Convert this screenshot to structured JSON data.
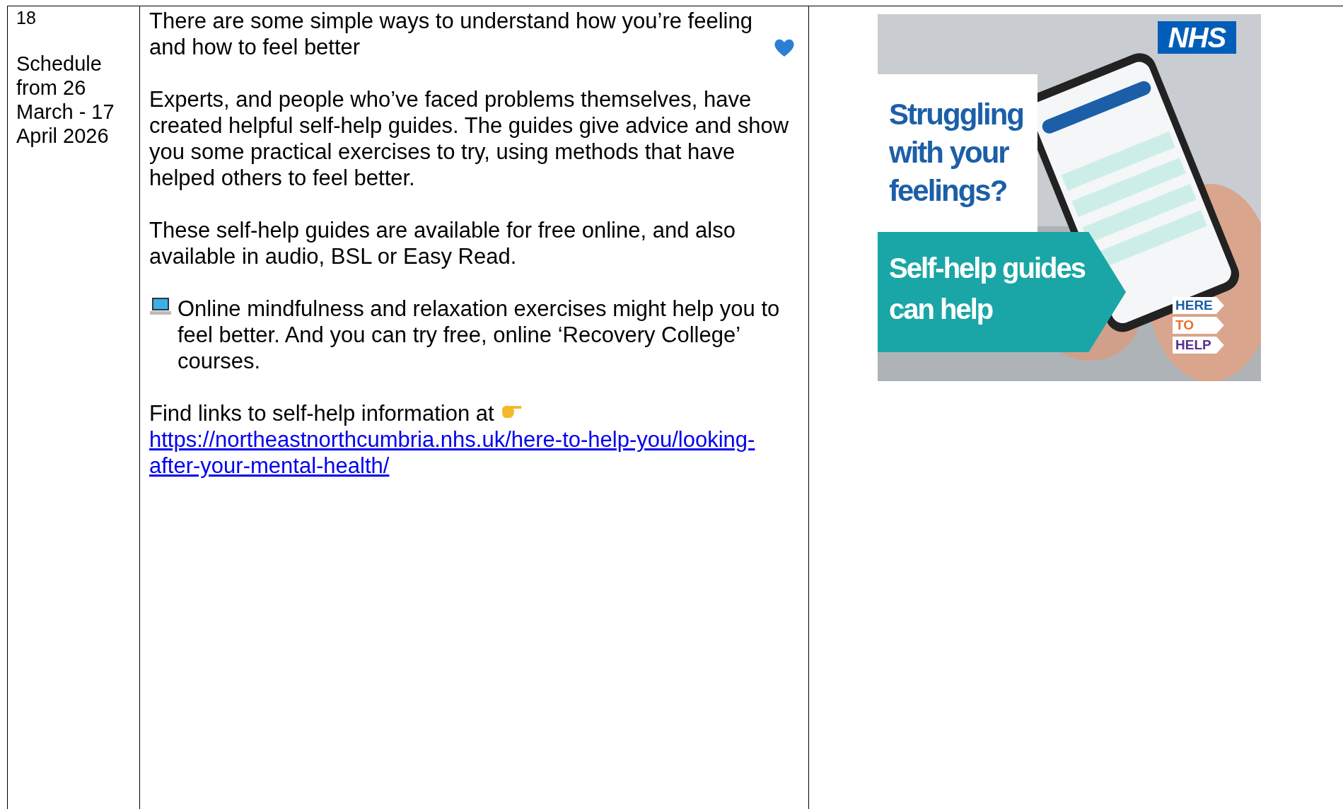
{
  "row": {
    "number": "18",
    "schedule": "Schedule from 26 March - 17 April 2026",
    "paragraphs": [
      {
        "kind": "heart",
        "text": "There are some simple ways to understand how you’re feeling and how to feel better"
      },
      {
        "kind": "plain",
        "text": "Experts, and people who’ve faced problems themselves, have created helpful self-help guides. The guides give advice and show you some practical exercises to try, using methods that have helped others to feel better."
      },
      {
        "kind": "plain",
        "text": "These self-help guides are available for free online, and also available in audio, BSL or Easy Read."
      },
      {
        "kind": "laptop",
        "text": "Online mindfulness and relaxation exercises might help you to feel better. And you can try free, online ‘Recovery College’ courses."
      },
      {
        "kind": "link",
        "text": "Find links to self-help information at",
        "link": "https://northeastnorthcumbria.nhs.uk/here-to-help-you/looking-after-your-mental-health/"
      }
    ],
    "poster": {
      "logo": "NHS",
      "headline": "Struggling with your feelings?",
      "banner": "Self-help guides can help",
      "tags": [
        "HERE",
        "TO",
        "HELP"
      ]
    }
  }
}
